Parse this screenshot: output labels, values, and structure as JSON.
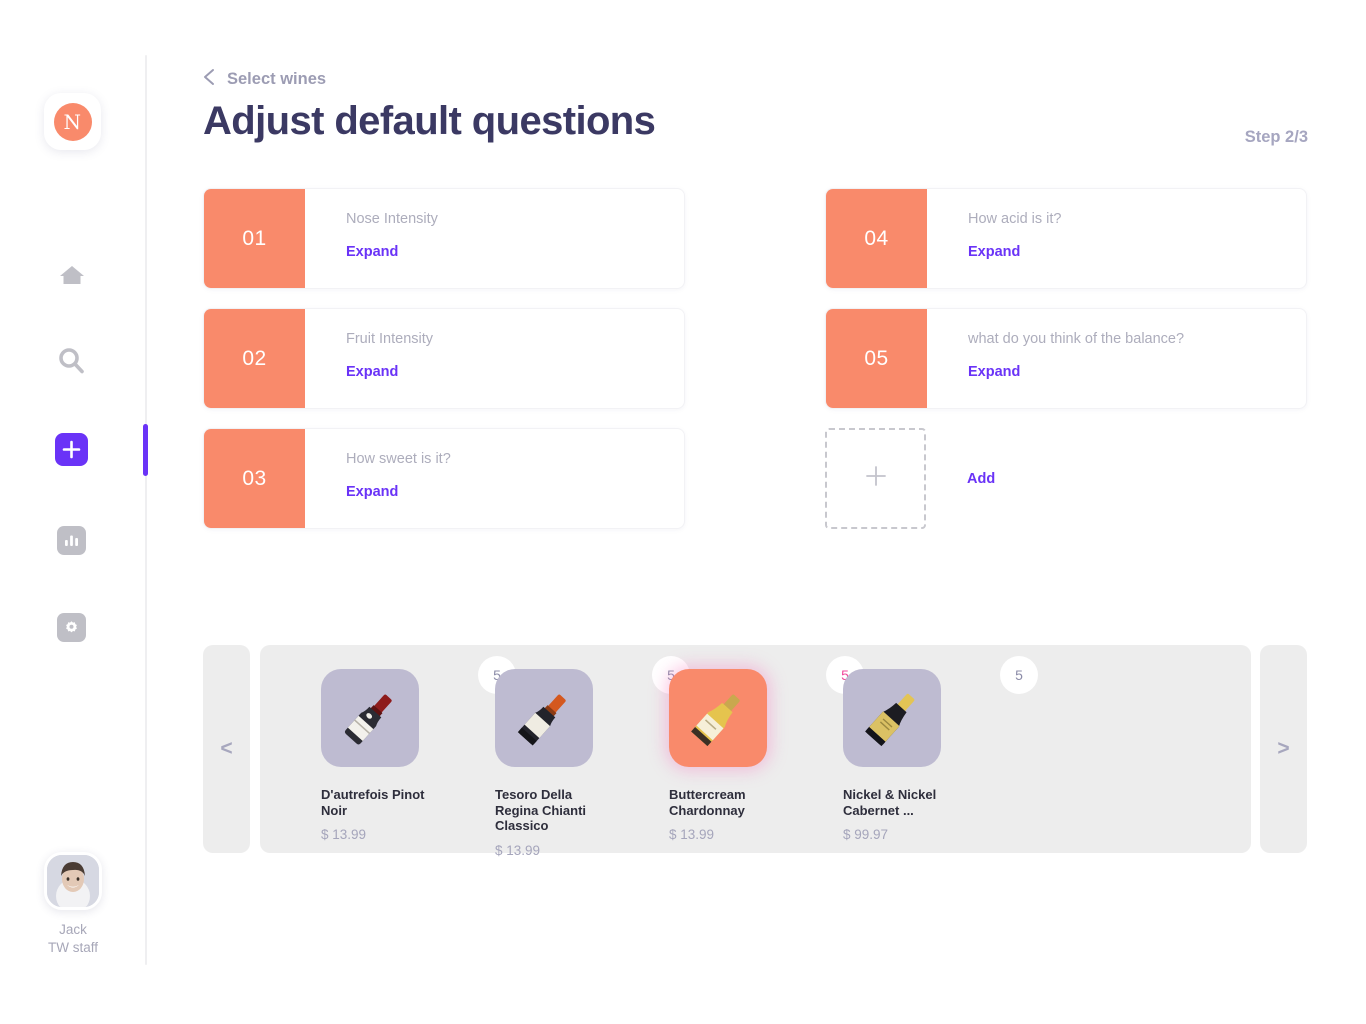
{
  "brand": {
    "logo_letter": "N",
    "logo_icon": "brand-logo-icon"
  },
  "sidebar": {
    "items": [
      {
        "name": "home",
        "icon": "home-icon"
      },
      {
        "name": "search",
        "icon": "search-icon"
      },
      {
        "name": "add",
        "icon": "plus-icon",
        "active": true
      },
      {
        "name": "stats",
        "icon": "bar-chart-icon"
      },
      {
        "name": "settings",
        "icon": "gear-icon"
      }
    ],
    "profile": {
      "name": "Jack",
      "role": "TW staff",
      "avatar_icon": "avatar-photo"
    }
  },
  "header": {
    "back_icon": "chevron-left-icon",
    "breadcrumb": "Select wines",
    "title": "Adjust default questions",
    "step": "Step 2/3"
  },
  "questions": {
    "expand_label": "Expand",
    "left": [
      {
        "number": "01",
        "text": "Nose Intensity"
      },
      {
        "number": "02",
        "text": "Fruit Intensity"
      },
      {
        "number": "03",
        "text": "How sweet is it?"
      }
    ],
    "right": [
      {
        "number": "04",
        "text": "How acid is it?"
      },
      {
        "number": "05",
        "text": "what do you think of the balance?"
      }
    ],
    "add": {
      "label": "Add",
      "icon": "plus-icon"
    }
  },
  "carousel": {
    "prev_label": "<",
    "next_label": ">",
    "prev_icon": "chevron-left-icon",
    "next_icon": "chevron-right-icon",
    "wines": [
      {
        "name": "D'autrefois Pinot Noir",
        "price": "$ 13.99",
        "badge": "5",
        "selected": false,
        "bottle": "red-wine-bottle"
      },
      {
        "name": "Tesoro Della Regina Chianti Classico",
        "price": "$ 13.99",
        "badge": "5",
        "selected": false,
        "bottle": "red-wine-bottle"
      },
      {
        "name": "Buttercream Chardonnay",
        "price": "$ 13.99",
        "badge": "5",
        "selected": true,
        "bottle": "white-wine-bottle"
      },
      {
        "name": "Nickel & Nickel Cabernet ...",
        "price": "$ 99.97",
        "badge": "5",
        "selected": false,
        "bottle": "gold-wine-bottle"
      }
    ]
  },
  "colors": {
    "accent_orange": "#F98A6B",
    "accent_purple": "#6A33F7",
    "title_navy": "#3B3963",
    "muted_gray": "#ADADBC",
    "badge_pink": "#F0469A",
    "thumb_lavender": "#BEBBD1",
    "carousel_bg": "#EDEDED"
  }
}
